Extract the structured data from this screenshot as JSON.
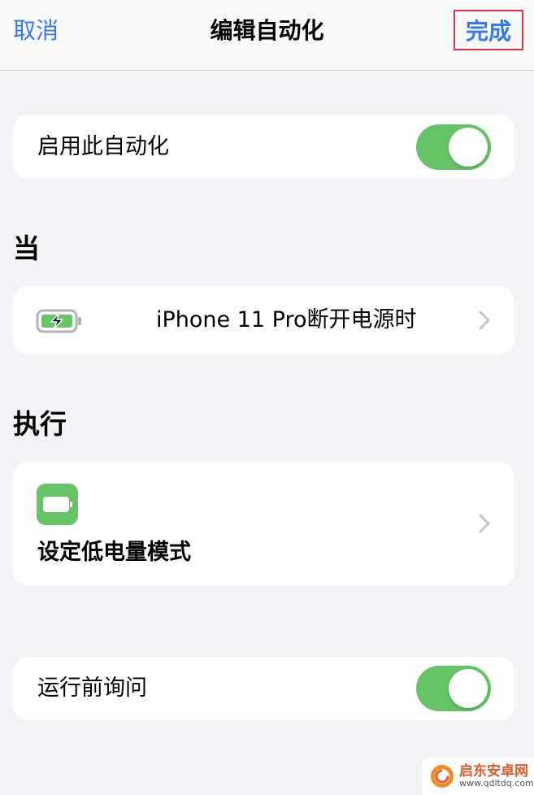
{
  "navbar": {
    "cancel_label": "取消",
    "title": "编辑自动化",
    "done_label": "完成"
  },
  "enable_row": {
    "label": "启用此自动化",
    "toggle_on": true
  },
  "when_section": {
    "header": "当",
    "trigger_icon": "battery-charging-icon",
    "trigger_text": "iPhone 11 Pro断开电源时"
  },
  "do_section": {
    "header": "执行",
    "action_icon": "battery-icon",
    "action_label": "设定低电量模式"
  },
  "ask_row": {
    "label": "运行前询问",
    "toggle_on": true
  },
  "watermark": {
    "name": "启东安卓网",
    "url": "www.qdltdq.com"
  },
  "colors": {
    "accent": "#3478f6",
    "toggle_green": "#65c466",
    "highlight_border": "#d9363e",
    "background": "#f2f2f7"
  }
}
